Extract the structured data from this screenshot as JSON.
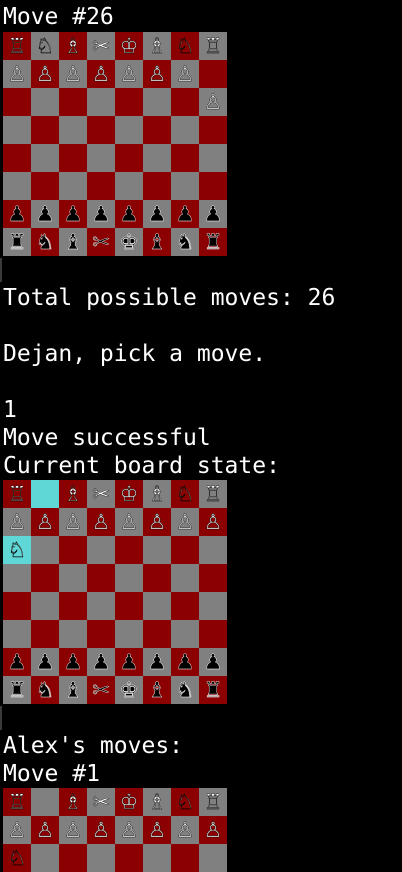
{
  "colors": {
    "dark_square": "#8b0000",
    "light_square": "#808080",
    "highlight_square": "#5fd7d7",
    "text": "#ffffff",
    "background": "#000000"
  },
  "header": {
    "move_label": "Move #26"
  },
  "board1": {
    "highlight": [],
    "rows": [
      [
        "♖",
        "♘",
        "♗",
        "✂",
        "♔",
        "♗",
        "♘",
        "♖"
      ],
      [
        "♙",
        "♙",
        "♙",
        "♙",
        "♙",
        "♙",
        "♙",
        ""
      ],
      [
        "",
        "",
        "",
        "",
        "",
        "",
        "",
        "♙"
      ],
      [
        "",
        "",
        "",
        "",
        "",
        "",
        "",
        ""
      ],
      [
        "",
        "",
        "",
        "",
        "",
        "",
        "",
        ""
      ],
      [
        "",
        "",
        "",
        "",
        "",
        "",
        "",
        ""
      ],
      [
        "♟",
        "♟",
        "♟",
        "♟",
        "♟",
        "♟",
        "♟",
        "♟"
      ],
      [
        "♜",
        "♞",
        "♝",
        "✂",
        "♚",
        "♝",
        "♞",
        "♜"
      ]
    ]
  },
  "text": {
    "total_moves": "Total possible moves: 26",
    "prompt": "Dejan, pick a move.",
    "input_value": "1",
    "move_result": "Move successful",
    "board_state_label": "Current board state:",
    "opponent_moves": "Alex's moves:",
    "move_label_2": "Move #1"
  },
  "board2": {
    "highlight": [
      [
        0,
        1
      ],
      [
        2,
        0
      ]
    ],
    "rows": [
      [
        "♖",
        "",
        "♗",
        "✂",
        "♔",
        "♗",
        "♘",
        "♖"
      ],
      [
        "♙",
        "♙",
        "♙",
        "♙",
        "♙",
        "♙",
        "♙",
        "♙"
      ],
      [
        "♘",
        "",
        "",
        "",
        "",
        "",
        "",
        ""
      ],
      [
        "",
        "",
        "",
        "",
        "",
        "",
        "",
        ""
      ],
      [
        "",
        "",
        "",
        "",
        "",
        "",
        "",
        ""
      ],
      [
        "",
        "",
        "",
        "",
        "",
        "",
        "",
        ""
      ],
      [
        "♟",
        "♟",
        "♟",
        "♟",
        "♟",
        "♟",
        "♟",
        "♟"
      ],
      [
        "♜",
        "♞",
        "♝",
        "✂",
        "♚",
        "♝",
        "♞",
        "♜"
      ]
    ]
  },
  "board3": {
    "highlight": [],
    "rows": [
      [
        "♖",
        "",
        "♗",
        "✂",
        "♔",
        "♗",
        "♘",
        "♖"
      ],
      [
        "♙",
        "♙",
        "♙",
        "♙",
        "♙",
        "♙",
        "♙",
        "♙"
      ],
      [
        "♘",
        "",
        "",
        "",
        "",
        "",
        "",
        ""
      ]
    ]
  }
}
